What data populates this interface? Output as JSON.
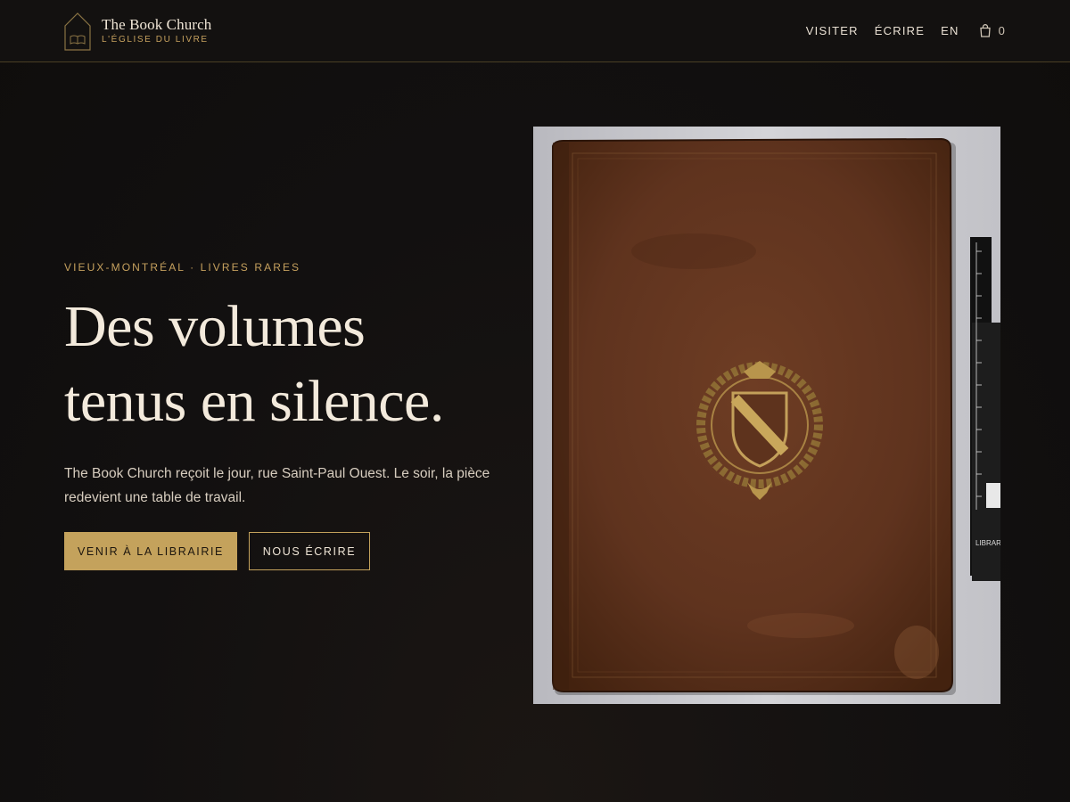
{
  "brand": {
    "name": "The Book Church",
    "subtitle": "L'ÉGLISE DU LIVRE",
    "logo_icon": "church-book-icon"
  },
  "nav": {
    "items": [
      {
        "label": "VISITER"
      },
      {
        "label": "ÉCRIRE"
      },
      {
        "label": "EN"
      }
    ],
    "cart": {
      "icon": "shopping-bag-icon",
      "count": "0"
    }
  },
  "hero": {
    "eyebrow": "VIEUX-MONTRÉAL · LIVRES RARES",
    "headline_line1": "Des volumes",
    "headline_line2": "tenus en silence.",
    "lead": "The Book Church reçoit le jour, rue Saint-Paul Ouest. Le soir, la pièce redevient une table de travail.",
    "primary_button": "VENIR À LA LIBRAIRIE",
    "secondary_button": "NOUS ÉCRIRE"
  },
  "photo": {
    "subject": "leather-bound-book-with-gilt-coat-of-arms",
    "ruler_text": "LIBRAR"
  },
  "colors": {
    "background": "#121010",
    "accent": "#c4a25c",
    "text": "#efe5d6",
    "leather": "#6a3a22"
  }
}
